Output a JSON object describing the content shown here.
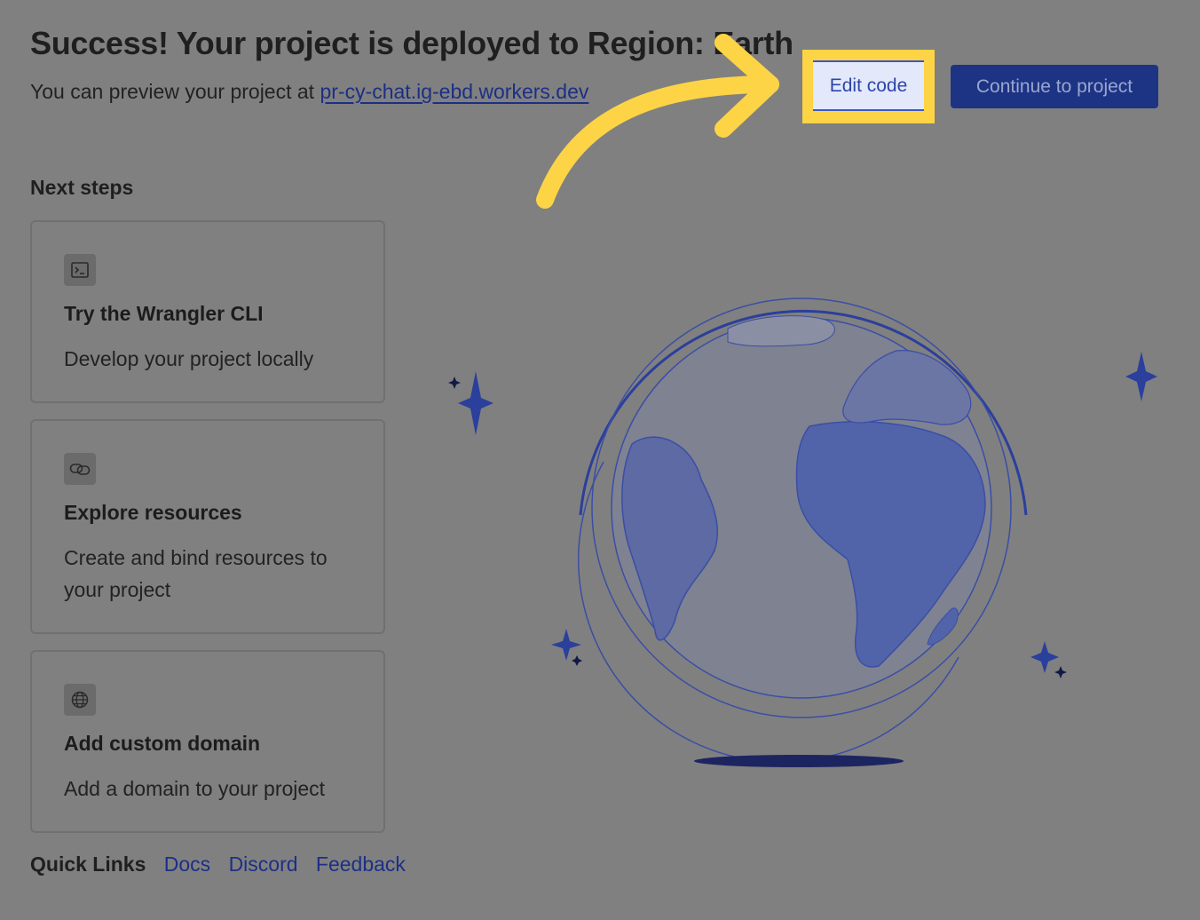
{
  "header": {
    "title": "Success! Your project is deployed to Region: Earth",
    "subtitle_prefix": "You can preview your project at ",
    "preview_link": "pr-cy-chat.ig-ebd.workers.dev"
  },
  "actions": {
    "edit_label": "Edit code",
    "continue_label": "Continue to project"
  },
  "next_steps": {
    "heading": "Next steps",
    "cards": [
      {
        "icon": "terminal-icon",
        "title": "Try the Wrangler CLI",
        "desc": "Develop your project locally"
      },
      {
        "icon": "link-icon",
        "title": "Explore resources",
        "desc": "Create and bind resources to your project"
      },
      {
        "icon": "globe-icon",
        "title": "Add custom domain",
        "desc": "Add a domain to your project"
      }
    ]
  },
  "quick_links": {
    "label": "Quick Links",
    "links": [
      "Docs",
      "Discord",
      "Feedback"
    ]
  },
  "colors": {
    "overlay_bg": "#808080",
    "accent_blue": "#1d3484",
    "highlight_yellow": "#fdd445",
    "globe_blue": "#3d4f9a"
  }
}
